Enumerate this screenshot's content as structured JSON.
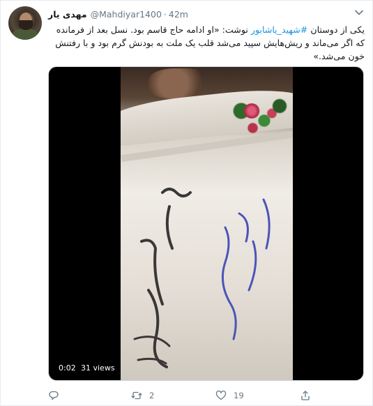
{
  "user": {
    "name": "مهدی یار",
    "handle": "@Mahdiyar1400",
    "separator": "·",
    "time": "42m"
  },
  "tweet": {
    "text_before": "یکی از دوستان ",
    "hashtag": "#شهید_یاشابور",
    "text_after": " نوشت: «او ادامه حاج قاسم بود. نسل بعد از فرمانده که اگر می‌ماند و ریش‌هایش سپید می‌شد قلب یک ملت به بودنش گرم بود و با رفتنش خون می‌شد.»"
  },
  "media": {
    "duration": "0:02",
    "views": "31 views"
  },
  "actions": {
    "reply_count": "",
    "retweet_count": "2",
    "like_count": "19",
    "share_count": ""
  },
  "icons": {
    "menu": "chevron-down-icon",
    "reply": "reply-icon",
    "retweet": "retweet-icon",
    "like": "heart-icon",
    "share": "share-icon"
  },
  "colors": {
    "link": "#1b95e0",
    "muted": "#657786",
    "text": "#14171a"
  }
}
